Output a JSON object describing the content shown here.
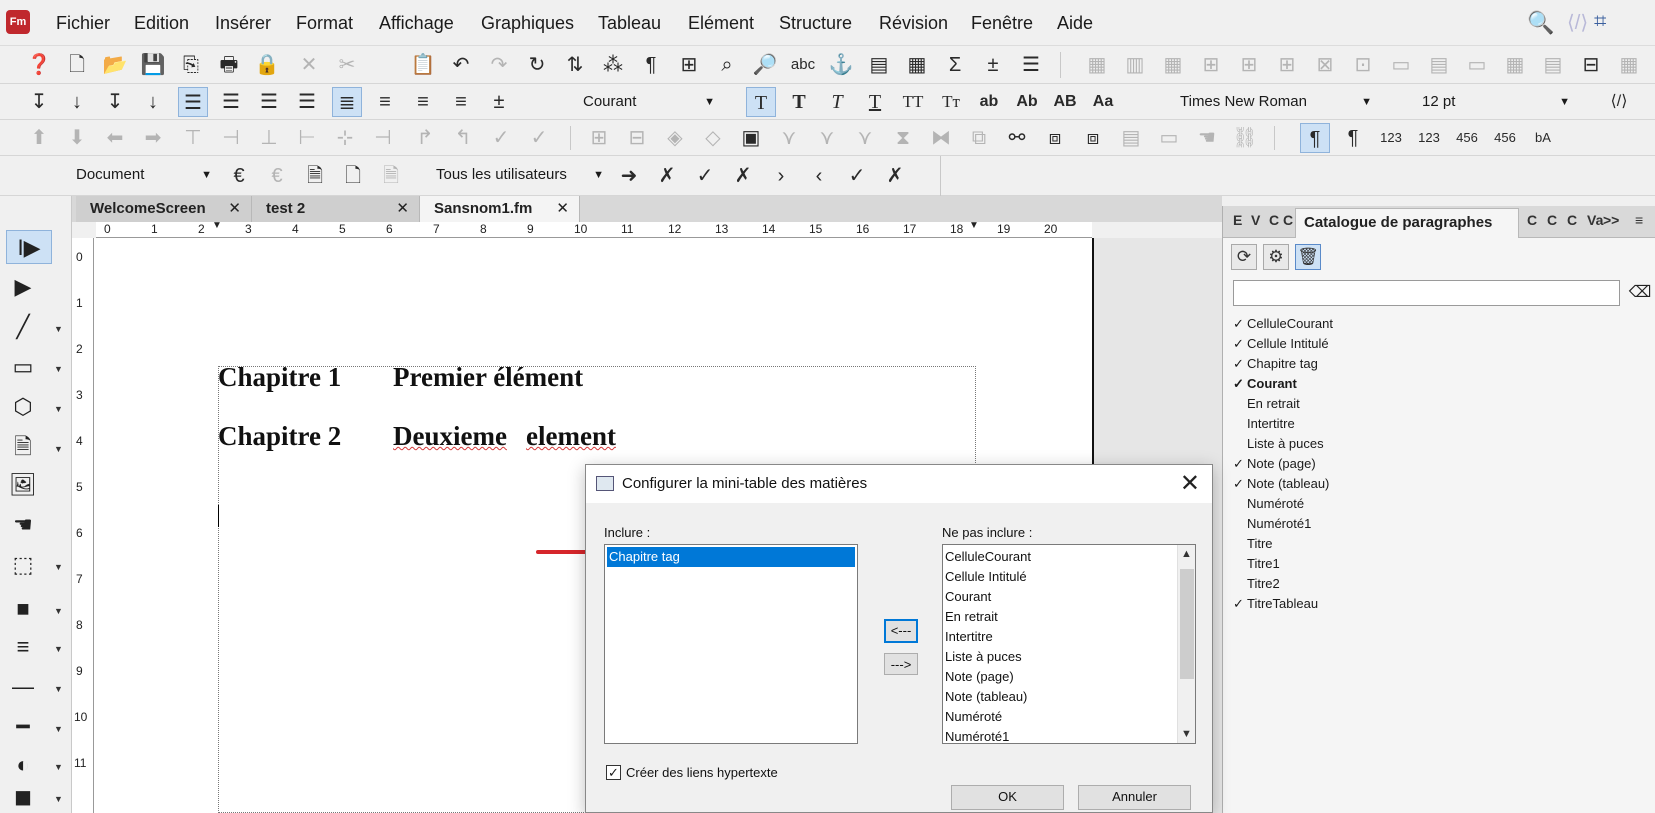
{
  "app": {
    "logo_text": "Fm",
    "brand_color": "#c0282d"
  },
  "menu": [
    "Fichier",
    "Edition",
    "Insérer",
    "Format",
    "Affichage",
    "Graphiques",
    "Tableau",
    "Elément",
    "Structure",
    "Révision",
    "Fenêtre",
    "Aide"
  ],
  "format_bar": {
    "paragraph_style": "Courant",
    "font_family": "Times New Roman",
    "font_size": "12 pt",
    "char_buttons": [
      "T",
      "T",
      "T",
      "T",
      "TT",
      "Tт",
      "ab",
      "Ab",
      "AB",
      "Aa"
    ]
  },
  "tracking_bar": {
    "scope": "Document",
    "users": "Tous les utilisateurs"
  },
  "doc_tabs": [
    {
      "label": "WelcomeScreen",
      "close": "✕"
    },
    {
      "label": "test 2",
      "close": "✕"
    },
    {
      "label": "Sansnom1.fm",
      "close": "✕"
    }
  ],
  "ruler": {
    "h_marks": [
      "0",
      "1",
      "2",
      "3",
      "4",
      "5",
      "6",
      "7",
      "8",
      "9",
      "10",
      "11",
      "12",
      "13",
      "14",
      "15",
      "16",
      "17",
      "18",
      "19",
      "20"
    ],
    "v_marks": [
      "0",
      "1",
      "2",
      "3",
      "4",
      "5",
      "6",
      "7",
      "8",
      "9",
      "10",
      "11"
    ]
  },
  "document": {
    "line1": {
      "label": "Chapitre 1",
      "text": "Premier élément"
    },
    "line2": {
      "label": "Chapitre 2",
      "text_a": "Deuxieme",
      "text_b": "element"
    }
  },
  "right_panel": {
    "mini_tabs_left": [
      "E",
      "V",
      "C",
      "C"
    ],
    "active_tab": "Catalogue de paragraphes",
    "mini_tabs_right": [
      "C",
      "C",
      "C",
      "Va"
    ],
    "overflow": ">>",
    "menu_icon": "≡",
    "clear_icon": "⌫",
    "items": [
      {
        "check": "✓",
        "label": "CelluleCourant"
      },
      {
        "check": "✓",
        "label": "Cellule Intitulé"
      },
      {
        "check": "✓",
        "label": "Chapitre tag"
      },
      {
        "check": "✓",
        "label": "Courant",
        "bold": true
      },
      {
        "check": "",
        "label": "En retrait"
      },
      {
        "check": "",
        "label": "Intertitre"
      },
      {
        "check": "",
        "label": "Liste à puces"
      },
      {
        "check": "✓",
        "label": "Note (page)"
      },
      {
        "check": "✓",
        "label": "Note (tableau)"
      },
      {
        "check": "",
        "label": "Numéroté"
      },
      {
        "check": "",
        "label": "Numéroté1"
      },
      {
        "check": "",
        "label": "Titre"
      },
      {
        "check": "",
        "label": "Titre1"
      },
      {
        "check": "",
        "label": "Titre2"
      },
      {
        "check": "✓",
        "label": "TitreTableau"
      }
    ]
  },
  "dialog": {
    "title": "Configurer la mini-table des matières",
    "close": "✕",
    "include_label": "Inclure :",
    "exclude_label": "Ne pas inclure :",
    "include_items": [
      "Chapitre tag"
    ],
    "exclude_items": [
      "CelluleCourant",
      "Cellule Intitulé",
      "Courant",
      "En retrait",
      "Intertitre",
      "Liste à puces",
      "Note (page)",
      "Note (tableau)",
      "Numéroté",
      "Numéroté1"
    ],
    "move_left": "<---",
    "move_right": "--->",
    "checkbox_label": "Créer des liens hypertexte",
    "checkbox_checked": true,
    "ok": "OK",
    "cancel": "Annuler"
  },
  "annotation_color": "#d6262b",
  "selection_color": "#0078d7"
}
